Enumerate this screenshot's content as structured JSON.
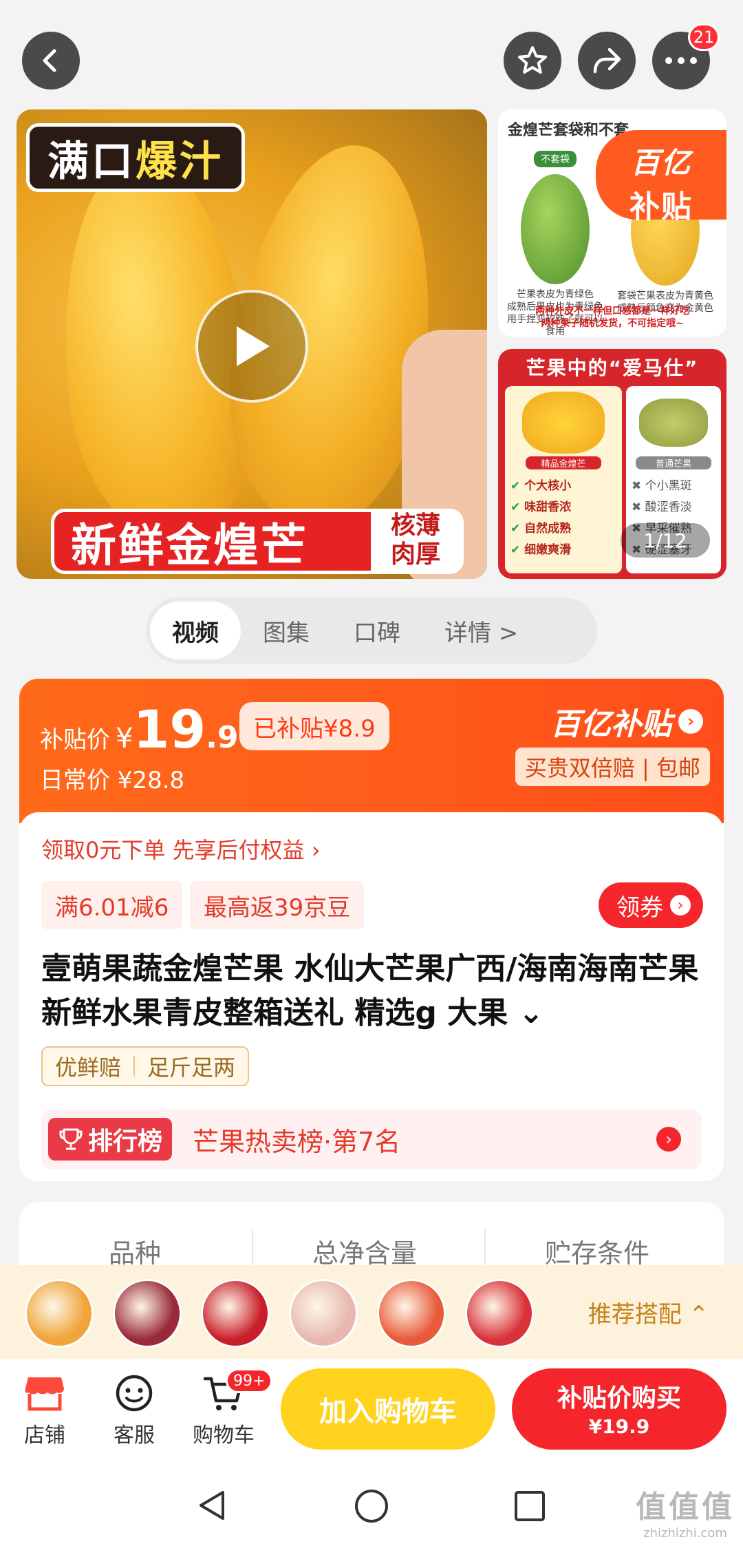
{
  "header": {
    "notification_count": "21"
  },
  "gallery": {
    "main_tag_part1": "满口",
    "main_tag_part2": "爆汁",
    "main_banner": "新鲜金煌芒",
    "main_banner_side_line1": "核薄",
    "main_banner_side_line2": "肉厚",
    "side_top_title": "金煌芒套袋和不套",
    "side_top_pill": "不套袋",
    "side_top_left_desc": [
      "芒果表皮为青绿色",
      "成熟后果皮也为青绿色",
      "用手捏变软熟了就可以食用"
    ],
    "side_top_right_desc": [
      "套袋芒果表皮为青黄色",
      "成熟后颜色变为金黄色"
    ],
    "side_top_bottom": [
      "两种外皮不一样但口感都是一样好吃",
      "两种果子随机发货，不可指定哦~"
    ],
    "yi_badge_line1": "百亿",
    "yi_badge_line2": "补贴",
    "side_bot_title": "芒果中的“爱马仕”",
    "side_bot_left_label": "精品金煌芒",
    "side_bot_right_label": "普通芒果",
    "side_bot_left_features": [
      "个大核小",
      "味甜香浓",
      "自然成熟",
      "细嫩爽滑"
    ],
    "side_bot_right_features": [
      "个小黑斑",
      "酸涩香淡",
      "早采催熟",
      "硬涩塞牙"
    ],
    "page_indicator": "1/12"
  },
  "tabs": [
    "视频",
    "图集",
    "口碑",
    "详情 >"
  ],
  "price": {
    "label": "补贴价",
    "yen": "¥",
    "int": "19",
    "dec": ".9",
    "subsidy_chip": "已补贴¥8.9",
    "daily_label": "日常价 ¥28.8",
    "yi_logo": "百亿补贴",
    "yi_sub": "买贵双倍赔 | 包邮"
  },
  "promo": {
    "pay_later": "领取0元下单 先享后付权益 ›",
    "chip1": "满6.01减6",
    "chip2": "最高返39京豆",
    "coupon": "领券"
  },
  "product": {
    "title": "壹萌果蔬金煌芒果 水仙大芒果广西/海南海南芒果新鲜水果青皮整箱送礼 精选g 大果 ⌄",
    "tag1": "优鲜赔",
    "tag2": "足斤足两",
    "rank_badge": "排行榜",
    "rank_text": "芒果热卖榜·第7名"
  },
  "specs": [
    "品种",
    "总净含量",
    "贮存条件"
  ],
  "recommend": {
    "label": "推荐搭配 ⌃",
    "thumbs": [
      "#f0a43a",
      "#9a2a3a",
      "#c81e2a",
      "#e8b8b0",
      "#e85a3a",
      "#d8323a"
    ]
  },
  "actions": {
    "store": "店铺",
    "service": "客服",
    "cart": "购物车",
    "cart_badge": "99+",
    "add_cart": "加入购物车",
    "buy_line1": "补贴价购买",
    "buy_line2": "¥19.9"
  },
  "watermark": {
    "line1": "值值值",
    "line2": "zhizhizhi.com"
  },
  "colors": {
    "accent_red": "#f4262b",
    "accent_orange": "#ff5a1a",
    "cart_yellow": "#ffd21e"
  }
}
